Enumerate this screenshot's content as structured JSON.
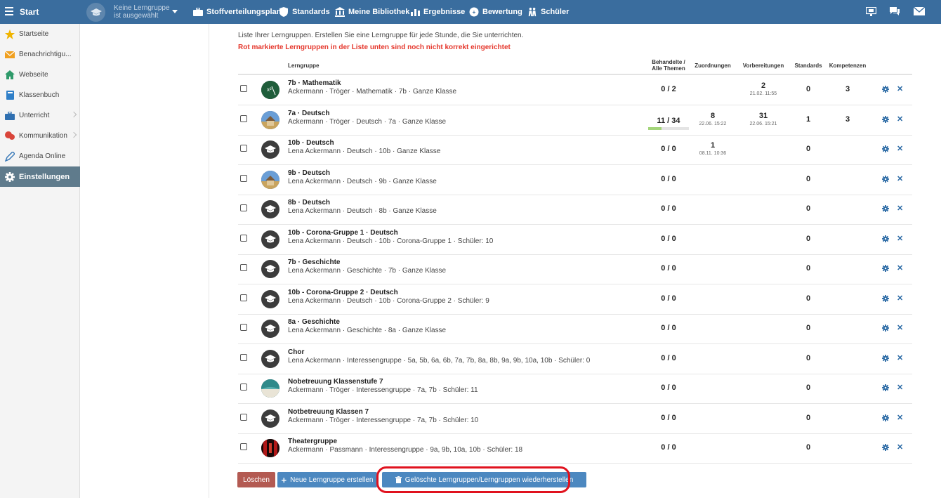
{
  "topbar": {
    "brand": "Start",
    "group_line1": "Keine Lerngruppe",
    "group_line2": "ist ausgewählt",
    "nav": [
      {
        "label": "Stoffverteilungsplan",
        "icon": "briefcase-icon"
      },
      {
        "label": "Standards",
        "icon": "shield-icon"
      },
      {
        "label": "Meine Bibliothek",
        "icon": "library-icon"
      },
      {
        "label": "Ergebnisse",
        "icon": "bar-chart-icon"
      },
      {
        "label": "Bewertung",
        "icon": "grading-icon"
      },
      {
        "label": "Schüler",
        "icon": "students-icon"
      }
    ]
  },
  "sidebar": {
    "items": [
      {
        "label": "Startseite",
        "icon": "star-icon"
      },
      {
        "label": "Benachrichtigu...",
        "icon": "envelope-icon"
      },
      {
        "label": "Webseite",
        "icon": "home-icon"
      },
      {
        "label": "Klassenbuch",
        "icon": "book-icon"
      },
      {
        "label": "Unterricht",
        "icon": "briefcase-icon"
      },
      {
        "label": "Kommunikation",
        "icon": "chat-icon"
      },
      {
        "label": "Agenda Online",
        "icon": "pen-icon"
      },
      {
        "label": "Einstellungen",
        "icon": "gear-icon"
      }
    ]
  },
  "main": {
    "intro": "Liste Ihrer Lerngruppen. Erstellen Sie eine Lerngruppe für jede Stunde, die Sie unterrichten.",
    "warning": "Rot markierte Lerngruppen in der Liste unten sind noch nicht korrekt eingerichtet",
    "columns": {
      "lerngruppe": "Lerngruppe",
      "behandelte_1": "Behandelte /",
      "behandelte_2": "Alle Themen",
      "zuordnungen": "Zuordnungen",
      "vorbereitungen": "Vorbereitungen",
      "standards": "Standards",
      "kompetenzen": "Kompetenzen"
    },
    "rows": [
      {
        "name": "7b · Mathematik",
        "sub": "Ackermann · Tröger · Mathematik · 7b · Ganze Klasse",
        "themen": "0 / 2",
        "zuord": "",
        "zuord_date": "",
        "vorb": "2",
        "vorb_date": "21.02. 11:55",
        "standards": "0",
        "kompetenzen": "3",
        "avatar": "math"
      },
      {
        "name": "7a · Deutsch",
        "sub": "Ackermann · Tröger · Deutsch · 7a · Ganze Klasse",
        "themen": "11 / 34",
        "progress": 0.32,
        "zuord": "8",
        "zuord_date": "22.06. 15:22",
        "vorb": "31",
        "vorb_date": "22.06. 15:21",
        "standards": "1",
        "kompetenzen": "3",
        "avatar": "house"
      },
      {
        "name": "10b · Deutsch",
        "sub": "Lena Ackermann · Deutsch · 10b · Ganze Klasse",
        "themen": "0 / 0",
        "zuord": "1",
        "zuord_date": "08.11. 10:36",
        "vorb": "",
        "vorb_date": "",
        "standards": "0",
        "kompetenzen": "",
        "avatar": "cap"
      },
      {
        "name": "9b · Deutsch",
        "sub": "Lena Ackermann · Deutsch · 9b · Ganze Klasse",
        "themen": "0 / 0",
        "zuord": "",
        "zuord_date": "",
        "vorb": "",
        "vorb_date": "",
        "standards": "0",
        "kompetenzen": "",
        "avatar": "house"
      },
      {
        "name": "8b · Deutsch",
        "sub": "Lena Ackermann · Deutsch · 8b · Ganze Klasse",
        "themen": "0 / 0",
        "zuord": "",
        "zuord_date": "",
        "vorb": "",
        "vorb_date": "",
        "standards": "0",
        "kompetenzen": "",
        "avatar": "cap"
      },
      {
        "name": "10b - Corona-Gruppe 1 · Deutsch",
        "sub": "Lena Ackermann · Deutsch · 10b · Corona-Gruppe 1 · Schüler: 10",
        "themen": "0 / 0",
        "zuord": "",
        "zuord_date": "",
        "vorb": "",
        "vorb_date": "",
        "standards": "0",
        "kompetenzen": "",
        "avatar": "cap"
      },
      {
        "name": "7b · Geschichte",
        "sub": "Lena Ackermann · Geschichte · 7b · Ganze Klasse",
        "themen": "0 / 0",
        "zuord": "",
        "zuord_date": "",
        "vorb": "",
        "vorb_date": "",
        "standards": "0",
        "kompetenzen": "",
        "avatar": "cap"
      },
      {
        "name": "10b - Corona-Gruppe 2 · Deutsch",
        "sub": "Lena Ackermann · Deutsch · 10b · Corona-Gruppe 2 · Schüler: 9",
        "themen": "0 / 0",
        "zuord": "",
        "zuord_date": "",
        "vorb": "",
        "vorb_date": "",
        "standards": "0",
        "kompetenzen": "",
        "avatar": "cap"
      },
      {
        "name": "8a · Geschichte",
        "sub": "Lena Ackermann · Geschichte · 8a · Ganze Klasse",
        "themen": "0 / 0",
        "zuord": "",
        "zuord_date": "",
        "vorb": "",
        "vorb_date": "",
        "standards": "0",
        "kompetenzen": "",
        "avatar": "cap"
      },
      {
        "name": "Chor",
        "sub": "Lena Ackermann · Interessengruppe · 5a, 5b, 6a, 6b, 7a, 7b, 8a, 8b, 9a, 9b, 10a, 10b · Schüler: 0",
        "themen": "0 / 0",
        "zuord": "",
        "zuord_date": "",
        "vorb": "",
        "vorb_date": "",
        "standards": "0",
        "kompetenzen": "",
        "avatar": "cap"
      },
      {
        "name": "Nobetreuung Klassenstufe 7",
        "sub": "Ackermann · Tröger · Interessengruppe · 7a, 7b · Schüler: 11",
        "themen": "0 / 0",
        "zuord": "",
        "zuord_date": "",
        "vorb": "",
        "vorb_date": "",
        "standards": "0",
        "kompetenzen": "",
        "avatar": "sea"
      },
      {
        "name": "Notbetreuung Klassen 7",
        "sub": "Ackermann · Tröger · Interessengruppe · 7a, 7b · Schüler: 10",
        "themen": "0 / 0",
        "zuord": "",
        "zuord_date": "",
        "vorb": "",
        "vorb_date": "",
        "standards": "0",
        "kompetenzen": "",
        "avatar": "cap"
      },
      {
        "name": "Theatergruppe",
        "sub": "Ackermann · Passmann · Interessengruppe · 9a, 9b, 10a, 10b · Schüler: 18",
        "themen": "0 / 0",
        "zuord": "",
        "zuord_date": "",
        "vorb": "",
        "vorb_date": "",
        "standards": "0",
        "kompetenzen": "",
        "avatar": "theater"
      }
    ]
  },
  "buttons": {
    "delete": "Löschen",
    "new_group": "Neue Lerngruppe erstellen",
    "restore": "Gelöschte Lerngruppen/Lerngruppen wiederherstellen"
  },
  "colors": {
    "topbar": "#3a6d9e",
    "sidebar_active": "#5f7b8c",
    "warning": "#e5372c",
    "action_blue": "#2b6aa5",
    "delete_button": "#b35a52",
    "highlight_ring": "#e0121e"
  }
}
